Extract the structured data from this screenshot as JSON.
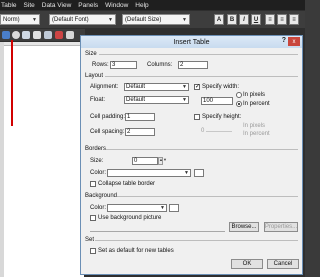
{
  "menubar": {
    "items": [
      "Table",
      "Site",
      "Data View",
      "Panels",
      "Window",
      "Help"
    ]
  },
  "toolbar": {
    "style_combo": "Norm)",
    "font_combo": "(Default Font)",
    "size_combo": "(Default Size)",
    "format_buttons": [
      "A",
      "B",
      "I",
      "U",
      "≡",
      "≡",
      "≡"
    ]
  },
  "dialog": {
    "title": "Insert Table",
    "help_label": "?",
    "close_label": "x",
    "size": {
      "section": "Size",
      "rows_label": "Rows:",
      "rows_value": "3",
      "columns_label": "Columns:",
      "columns_value": "2"
    },
    "layout": {
      "section": "Layout",
      "alignment_label": "Alignment:",
      "alignment_value": "Default",
      "float_label": "Float:",
      "float_value": "Default",
      "cell_padding_label": "Cell padding:",
      "cell_padding_value": "1",
      "cell_spacing_label": "Cell spacing:",
      "cell_spacing_value": "2",
      "specify_width_label": "Specify width:",
      "specify_width_checked": "✓",
      "width_value": "100",
      "in_pixels_label": "In pixels",
      "in_percent_label": "In percent",
      "specify_height_label": "Specify height:",
      "height_value": "0",
      "height_in_pixels_label": "In pixels",
      "height_in_percent_label": "In percent"
    },
    "borders": {
      "section": "Borders",
      "size_label": "Size:",
      "size_value": "0",
      "color_label": "Color:",
      "collapse_label": "Collapse table border"
    },
    "background": {
      "section": "Background",
      "color_label": "Color:",
      "use_picture_label": "Use background picture",
      "browse_label": "Browse...",
      "properties_label": "Properties..."
    },
    "set": {
      "section": "Set",
      "default_label": "Set as default for new tables"
    },
    "ok_label": "OK",
    "cancel_label": "Cancel"
  }
}
